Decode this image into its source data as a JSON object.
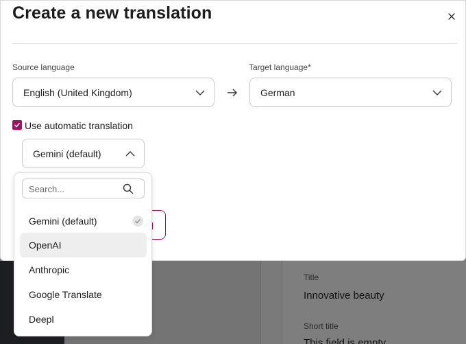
{
  "background": {
    "fields": [
      {
        "label": "Title",
        "value": "Innovative beauty"
      },
      {
        "label": "Short title",
        "value": "This field is empty"
      }
    ]
  },
  "modal": {
    "title": "Create a new translation",
    "source": {
      "label": "Source language",
      "value": "English (United Kingdom)"
    },
    "target": {
      "label": "Target language*",
      "value": "German"
    },
    "auto_translate": {
      "label": "Use automatic translation",
      "checked": true
    },
    "engine": {
      "value": "Gemini (default)"
    },
    "partial_button": {
      "label": "l"
    }
  },
  "dropdown": {
    "search_placeholder": "Search...",
    "options": [
      {
        "label": "Gemini (default)",
        "selected": true
      },
      {
        "label": "OpenAI",
        "hovered": true
      },
      {
        "label": "Anthropic"
      },
      {
        "label": "Google Translate"
      },
      {
        "label": "Deepl"
      }
    ]
  },
  "colors": {
    "accent": "#a3125e"
  }
}
